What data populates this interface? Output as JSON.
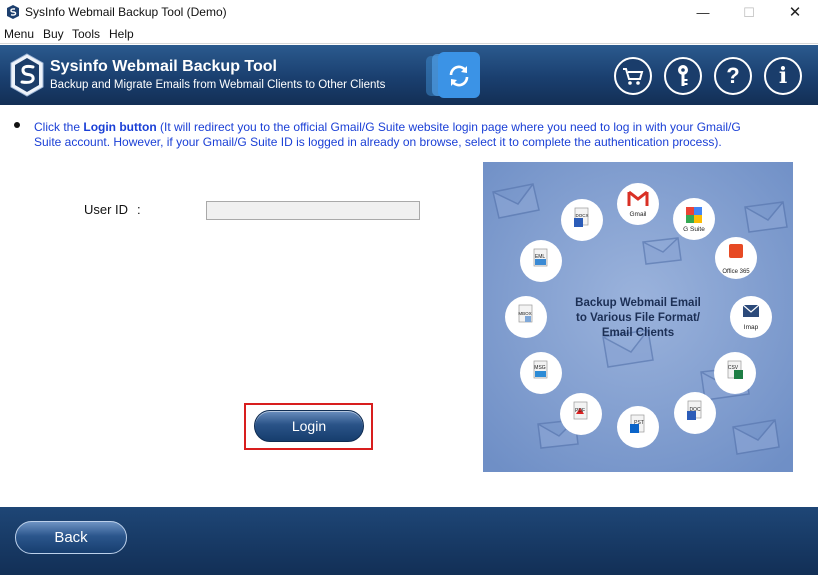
{
  "window": {
    "title": "SysInfo Webmail Backup Tool (Demo)",
    "minimize": "—",
    "maximize": "☐",
    "close": "✕"
  },
  "menu": [
    "Menu",
    "Buy",
    "Tools",
    "Help"
  ],
  "header": {
    "title": "Sysinfo Webmail Backup Tool",
    "subtitle": "Backup and Migrate Emails from Webmail Clients to Other Clients",
    "buttons": [
      {
        "name": "cart-icon",
        "glyph": "🛒"
      },
      {
        "name": "key-icon",
        "glyph": "⚷"
      },
      {
        "name": "help-icon",
        "glyph": "?"
      },
      {
        "name": "info-icon",
        "glyph": "i"
      }
    ]
  },
  "instruction": {
    "prefix": "Click the ",
    "bold": "Login button",
    "rest": " (It will redirect you to the official Gmail/G Suite website login page where you need to log in with your Gmail/G Suite account. However, if your Gmail/G Suite ID is logged in already on browse, select it to complete the authentication process)."
  },
  "form": {
    "userid_label": "User ID",
    "colon": ":",
    "userid_value": ""
  },
  "login_label": "Login",
  "back_label": "Back",
  "illustration": {
    "center_lines": [
      "Backup Webmail Email",
      "to Various File Format/",
      "Email Clients"
    ],
    "badges": [
      {
        "label": "Gmail"
      },
      {
        "label": "G Suite"
      },
      {
        "label": "Office 365"
      },
      {
        "label": "Imap"
      },
      {
        "label": "CSV"
      },
      {
        "label": "DOC"
      },
      {
        "label": "PST"
      },
      {
        "label": "PDF"
      },
      {
        "label": "MSG"
      },
      {
        "label": "MBOX"
      },
      {
        "label": "EML"
      },
      {
        "label": "DOCX"
      }
    ]
  },
  "colors": {
    "header_bg": "#1a3f6f",
    "instruction_text": "#1a3fd6",
    "highlight_frame": "#d81e1e",
    "illustration_bg": "#7f9ccf"
  }
}
